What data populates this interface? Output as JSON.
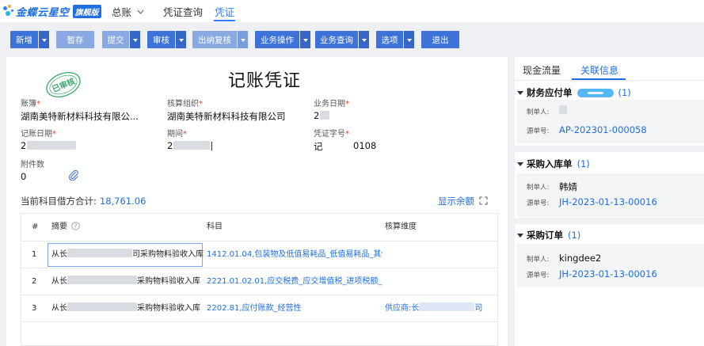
{
  "nav": {
    "logo_text": "金蝶云星空",
    "logo_badge": "旗舰版",
    "menu_ledger": "总账",
    "tab_query": "凭证查询",
    "tab_voucher": "凭证"
  },
  "toolbar": {
    "new": "新增",
    "save": "暂存",
    "submit": "提交",
    "audit": "审核",
    "cashier": "出纳复核",
    "biz_op": "业务操作",
    "biz_query": "业务查询",
    "options": "选项",
    "exit": "退出"
  },
  "voucher": {
    "stamp_text": "已审核",
    "title": "记账凭证",
    "book_label": "账簿",
    "book_value": "湖南美特新材料科技有限公...",
    "org_label": "核算组织",
    "org_value": "湖南美特新材料科技有限公司",
    "bizdate_label": "业务日期",
    "bizdate_value": "2",
    "postdate_label": "记账日期",
    "postdate_value": "2",
    "period_label": "期间",
    "period_value": "2",
    "period_suffix": "|",
    "voucher_no_label": "凭证字号",
    "voucher_word": "记",
    "voucher_no": "0108",
    "attach_label": "附件数",
    "attach_value": "0",
    "sum_label": "当前科目借方合计:",
    "sum_value": "18,761.06",
    "show_balance": "显示余额"
  },
  "table": {
    "headers": {
      "idx": "#",
      "summary": "摘要",
      "account": "科目",
      "dimension": "核算维度"
    },
    "rows": [
      {
        "idx": "1",
        "summary_pre": "从长",
        "summary_post": "司采购物料验收入库",
        "account": "1412.01.04,包装物及低值易耗品_低值易耗品_其他",
        "dimension": ""
      },
      {
        "idx": "2",
        "summary_pre": "从长",
        "summary_post": "采购物料验收入库",
        "account": "2221.01.02.01,应交税费_应交增值税_进项税额_...",
        "dimension": ""
      },
      {
        "idx": "3",
        "summary_pre": "从长",
        "summary_post": "采购物料验收入库",
        "account": "2202.81,应付账款_经营性",
        "dimension_pre": "供应商:长",
        "dimension_post": "司"
      }
    ]
  },
  "right_panel": {
    "tab_cash": "现金流量",
    "tab_related": "关联信息",
    "sections": [
      {
        "title": "财务应付单",
        "count": "(1)",
        "maker_label": "制单人:",
        "maker": "",
        "source_label": "源单号:",
        "source": "AP-202301-000058"
      },
      {
        "title": "采购入库单",
        "count": "(1)",
        "maker_label": "制单人:",
        "maker": "韩婧",
        "source_label": "源单号:",
        "source": "JH-2023-01-13-00016"
      },
      {
        "title": "采购订单",
        "count": "(1)",
        "maker_label": "制单人:",
        "maker": "kingdee2",
        "source_label": "源单号:",
        "source": "JH-2023-01-13-00016"
      }
    ]
  },
  "colors": {
    "primary": "#3d72d9",
    "link": "#1f6fe0",
    "required": "#e0412e",
    "stamp": "#3aa86b"
  }
}
